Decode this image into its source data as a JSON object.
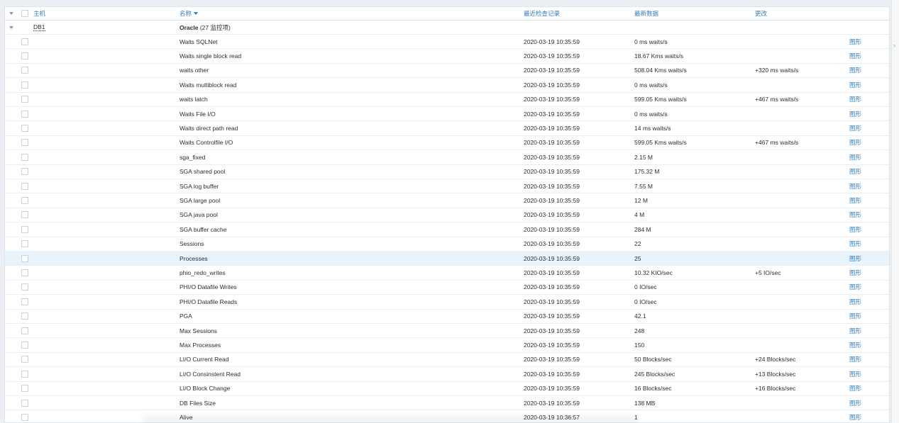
{
  "header": {
    "host": "主机",
    "name": "名称",
    "last_check": "最近检查记录",
    "latest_data": "最新数据",
    "change": "更改"
  },
  "group": {
    "host": "DB1",
    "name": "Oracle",
    "count": "(27 监控项)"
  },
  "graph_label": "图形",
  "right_mark": "›",
  "items": [
    {
      "name": "Waits SQLNet",
      "time": "2020-03-19 10:35:59",
      "data": "0 ms waits/s",
      "change": "",
      "graph": "图形"
    },
    {
      "name": "Waits single block read",
      "time": "2020-03-19 10:35:59",
      "data": "18.67 Kms waits/s",
      "change": "",
      "graph": "图形"
    },
    {
      "name": "waits other",
      "time": "2020-03-19 10:35:59",
      "data": "508.04 Kms waits/s",
      "change": "+320 ms waits/s",
      "graph": "图形"
    },
    {
      "name": "Waits multiblock read",
      "time": "2020-03-19 10:35:59",
      "data": "0 ms waits/s",
      "change": "",
      "graph": "图形"
    },
    {
      "name": "waits latch",
      "time": "2020-03-19 10:35:59",
      "data": "599.05 Kms waits/s",
      "change": "+467 ms waits/s",
      "graph": "图形"
    },
    {
      "name": "Waits File I/O",
      "time": "2020-03-19 10:35:59",
      "data": "0 ms waits/s",
      "change": "",
      "graph": "图形"
    },
    {
      "name": "Waits direct path read",
      "time": "2020-03-19 10:35:59",
      "data": "14 ms waits/s",
      "change": "",
      "graph": "图形"
    },
    {
      "name": "Waits Controlfile I/O",
      "time": "2020-03-19 10:35:59",
      "data": "599.05 Kms waits/s",
      "change": "+467 ms waits/s",
      "graph": "图形"
    },
    {
      "name": "sga_fixed",
      "time": "2020-03-19 10:35:59",
      "data": "2.15 M",
      "change": "",
      "graph": "图形"
    },
    {
      "name": "SGA shared pool",
      "time": "2020-03-19 10:35:59",
      "data": "175.32 M",
      "change": "",
      "graph": "图形"
    },
    {
      "name": "SGA log buffer",
      "time": "2020-03-19 10:35:59",
      "data": "7.55 M",
      "change": "",
      "graph": "图形"
    },
    {
      "name": "SGA large pool",
      "time": "2020-03-19 10:35:59",
      "data": "12 M",
      "change": "",
      "graph": "图形"
    },
    {
      "name": "SGA java pool",
      "time": "2020-03-19 10:35:59",
      "data": "4 M",
      "change": "",
      "graph": "图形"
    },
    {
      "name": "SGA buffer cache",
      "time": "2020-03-19 10:35:59",
      "data": "284 M",
      "change": "",
      "graph": "图形"
    },
    {
      "name": "Sessions",
      "time": "2020-03-19 10:35:59",
      "data": "22",
      "change": "",
      "graph": "图形"
    },
    {
      "name": "Processes",
      "time": "2020-03-19 10:35:59",
      "data": "25",
      "change": "",
      "graph": "图形",
      "highlight": true
    },
    {
      "name": "phio_redo_writes",
      "time": "2020-03-19 10:35:59",
      "data": "10.32 KIO/sec",
      "change": "+5 IO/sec",
      "graph": "图形"
    },
    {
      "name": "PHI/O Datafile Writes",
      "time": "2020-03-19 10:35:59",
      "data": "0 IO/sec",
      "change": "",
      "graph": "图形"
    },
    {
      "name": "PHI/O Datafile Reads",
      "time": "2020-03-19 10:35:59",
      "data": "0 IO/sec",
      "change": "",
      "graph": "图形"
    },
    {
      "name": "PGA",
      "time": "2020-03-19 10:35:59",
      "data": "42.1",
      "change": "",
      "graph": "图形"
    },
    {
      "name": "Max Sessions",
      "time": "2020-03-19 10:35:59",
      "data": "248",
      "change": "",
      "graph": "图形"
    },
    {
      "name": "Max Processes",
      "time": "2020-03-19 10:35:59",
      "data": "150",
      "change": "",
      "graph": "图形"
    },
    {
      "name": "LI/O Current Read",
      "time": "2020-03-19 10:35:59",
      "data": "50 Blocks/sec",
      "change": "+24 Blocks/sec",
      "graph": "图形"
    },
    {
      "name": "LI/O Consinstent Read",
      "time": "2020-03-19 10:35:59",
      "data": "245 Blocks/sec",
      "change": "+13 Blocks/sec",
      "graph": "图形"
    },
    {
      "name": "LI/O Block Change",
      "time": "2020-03-19 10:35:59",
      "data": "16 Blocks/sec",
      "change": "+16 Blocks/sec",
      "graph": "图形"
    },
    {
      "name": "DB Files Size",
      "time": "2020-03-19 10:35:59",
      "data": "138 MB",
      "change": "",
      "graph": "图形"
    },
    {
      "name": "Alive",
      "time": "2020-03-19 10:36:57",
      "data": "1",
      "change": "",
      "graph": "图形"
    }
  ]
}
